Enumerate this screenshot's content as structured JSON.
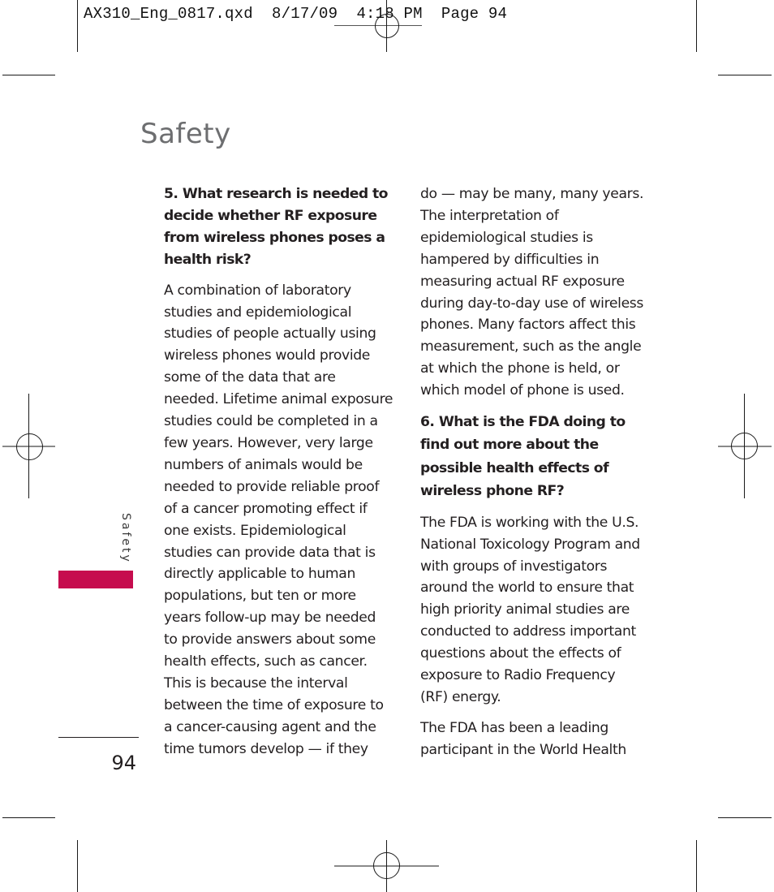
{
  "slug_line": "AX310_Eng_0817.qxd  8/17/09  4:18 PM  Page 94",
  "section_title": "Safety",
  "side_tab": {
    "label": "Safety",
    "color": "#c60c4e"
  },
  "page_number": "94",
  "left_column": {
    "question_lines": [
      "5. What research is needed to",
      "decide whether RF exposure",
      "from wireless phones poses a",
      "health risk?"
    ],
    "body_lines": [
      "A combination of laboratory",
      "studies and epidemiological",
      "studies of people actually using",
      "wireless phones would provide",
      "some of the data that are",
      "needed. Lifetime animal exposure",
      "studies could be completed in a",
      "few years. However, very large",
      "numbers of animals would be",
      "needed to provide reliable proof",
      "of a cancer promoting effect if",
      "one exists. Epidemiological",
      "studies can provide data that is",
      "directly applicable to human",
      "populations, but ten or more",
      "years follow-up may be needed",
      "to provide answers about some",
      "health effects, such as cancer.",
      "This is because the interval",
      "between the time of exposure to",
      "a cancer-causing agent and the",
      "time tumors develop — if they"
    ]
  },
  "right_column": {
    "continued_lines": [
      "do — may be many, many years.",
      "The interpretation of",
      "epidemiological studies is",
      "hampered by difficulties in",
      "measuring actual RF exposure",
      "during day-to-day use of wireless",
      "phones. Many factors affect this",
      "measurement, such as the angle",
      "at which the phone is held, or",
      "which model of phone is used."
    ],
    "question_lines": [
      "6. What is the FDA doing to",
      "find out more about the",
      "possible health effects of",
      "wireless phone RF?"
    ],
    "body1_lines": [
      "The FDA is working with the U.S.",
      "National Toxicology Program and",
      "with groups of investigators",
      "around the world to ensure that",
      "high priority animal studies are",
      "conducted to address important",
      "questions about the effects of",
      "exposure to Radio Frequency",
      "(RF) energy."
    ],
    "body2_lines": [
      "The FDA has been a leading",
      "participant in the World Health"
    ]
  }
}
